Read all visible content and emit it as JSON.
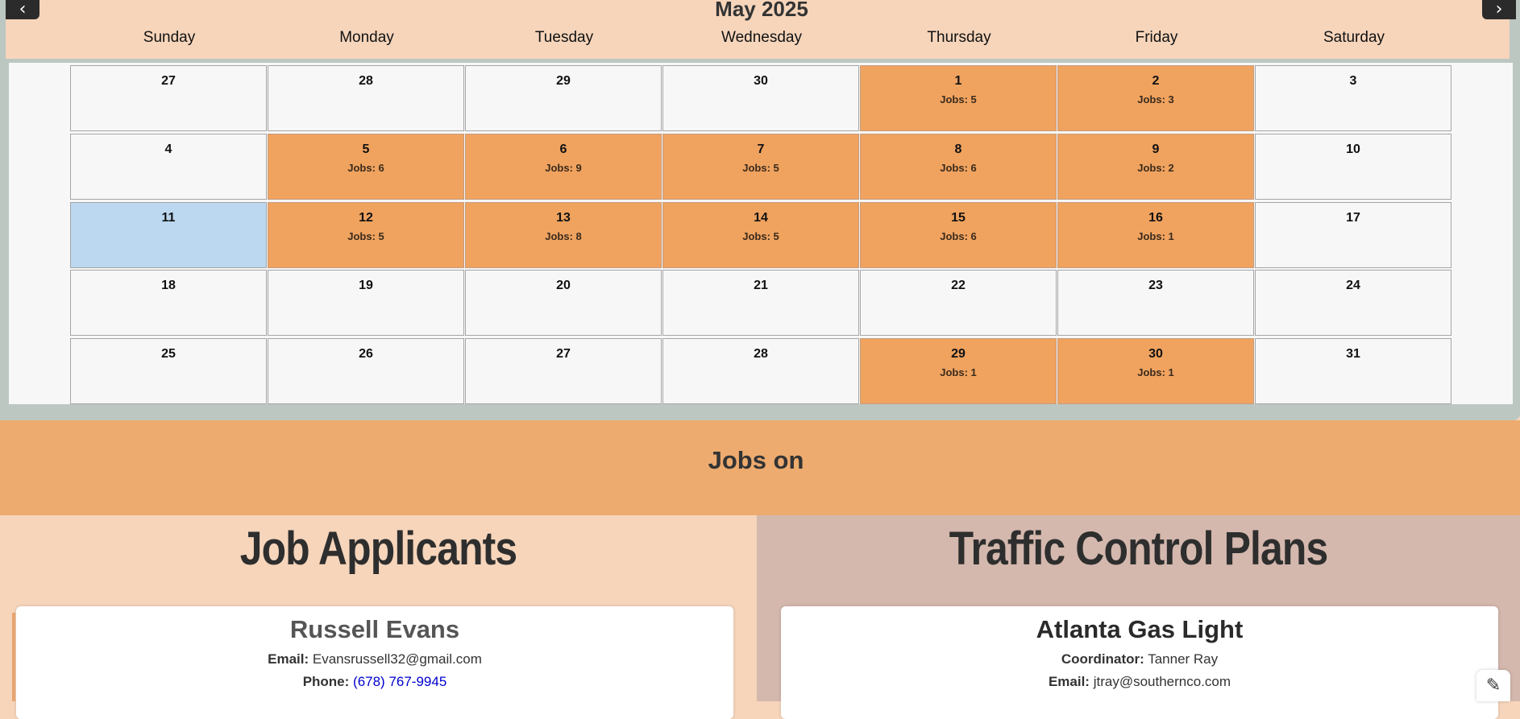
{
  "calendar": {
    "month_title": "May 2025",
    "prev_icon": "‹",
    "next_icon": "›",
    "weekdays": [
      "Sunday",
      "Monday",
      "Tuesday",
      "Wednesday",
      "Thursday",
      "Friday",
      "Saturday"
    ],
    "weeks": [
      [
        {
          "day": "27",
          "jobs": ""
        },
        {
          "day": "28",
          "jobs": ""
        },
        {
          "day": "29",
          "jobs": ""
        },
        {
          "day": "30",
          "jobs": ""
        },
        {
          "day": "1",
          "jobs": "Jobs: 5"
        },
        {
          "day": "2",
          "jobs": "Jobs: 3"
        },
        {
          "day": "3",
          "jobs": ""
        }
      ],
      [
        {
          "day": "4",
          "jobs": ""
        },
        {
          "day": "5",
          "jobs": "Jobs: 6"
        },
        {
          "day": "6",
          "jobs": "Jobs: 9"
        },
        {
          "day": "7",
          "jobs": "Jobs: 5"
        },
        {
          "day": "8",
          "jobs": "Jobs: 6"
        },
        {
          "day": "9",
          "jobs": "Jobs: 2"
        },
        {
          "day": "10",
          "jobs": ""
        }
      ],
      [
        {
          "day": "11",
          "jobs": "",
          "today": true
        },
        {
          "day": "12",
          "jobs": "Jobs: 5"
        },
        {
          "day": "13",
          "jobs": "Jobs: 8"
        },
        {
          "day": "14",
          "jobs": "Jobs: 5"
        },
        {
          "day": "15",
          "jobs": "Jobs: 6"
        },
        {
          "day": "16",
          "jobs": "Jobs: 1"
        },
        {
          "day": "17",
          "jobs": ""
        }
      ],
      [
        {
          "day": "18",
          "jobs": ""
        },
        {
          "day": "19",
          "jobs": ""
        },
        {
          "day": "20",
          "jobs": ""
        },
        {
          "day": "21",
          "jobs": ""
        },
        {
          "day": "22",
          "jobs": ""
        },
        {
          "day": "23",
          "jobs": ""
        },
        {
          "day": "24",
          "jobs": ""
        }
      ],
      [
        {
          "day": "25",
          "jobs": ""
        },
        {
          "day": "26",
          "jobs": ""
        },
        {
          "day": "27",
          "jobs": ""
        },
        {
          "day": "28",
          "jobs": ""
        },
        {
          "day": "29",
          "jobs": "Jobs: 1"
        },
        {
          "day": "30",
          "jobs": "Jobs: 1"
        },
        {
          "day": "31",
          "jobs": ""
        }
      ]
    ]
  },
  "jobs_banner": {
    "title": "Jobs on"
  },
  "applicants": {
    "title": "Job Applicants",
    "card": {
      "name": "Russell Evans",
      "email_label": "Email:",
      "email": "Evansrussell32@gmail.com",
      "phone_label": "Phone:",
      "phone": "(678) 767-9945"
    }
  },
  "plans": {
    "title": "Traffic Control Plans",
    "card": {
      "name": "Atlanta Gas Light",
      "coordinator_label": "Coordinator:",
      "coordinator": "Tanner Ray",
      "email_label": "Email:",
      "email": "jtray@southernco.com"
    }
  },
  "assistant": {
    "icon": "✎"
  },
  "colors": {
    "header_bg": "#f6d5bb",
    "jobs_day_bg": "#f0a35f",
    "today_bg": "#bbd8f0",
    "banner_bg": "#edab6f",
    "right_panel_bg": "#d4b8ad"
  }
}
